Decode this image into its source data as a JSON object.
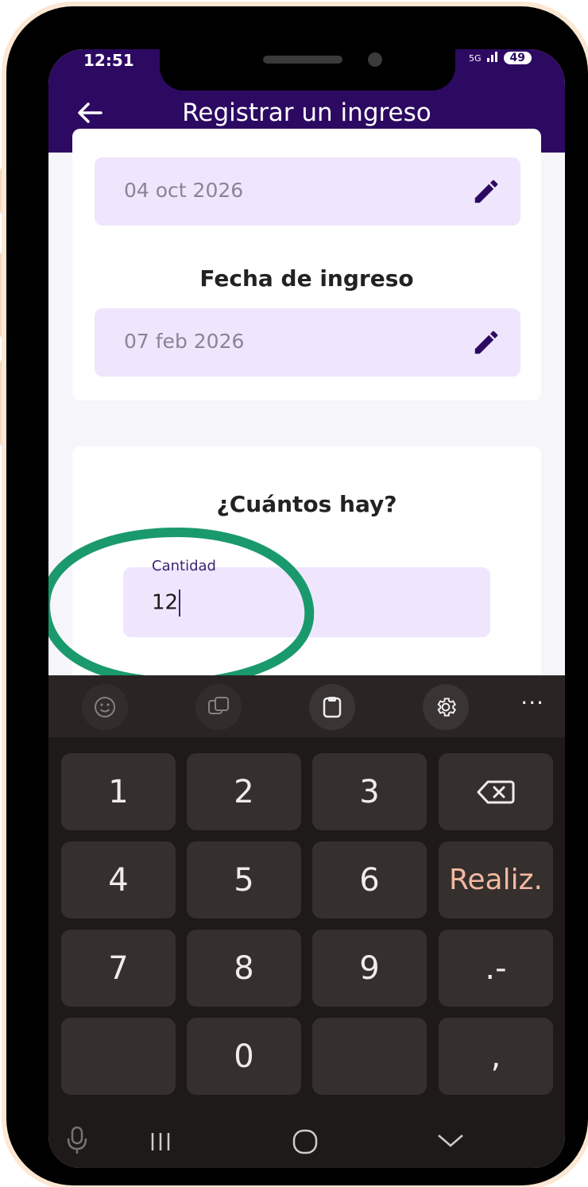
{
  "status_bar": {
    "time": "12:51",
    "network": "5G",
    "battery": "49"
  },
  "app_bar": {
    "title": "Registrar un ingreso"
  },
  "fields": {
    "first_date": {
      "value": "04 oct 2026"
    },
    "income_date": {
      "label": "Fecha de ingreso",
      "value": "07 feb 2026"
    }
  },
  "quantity": {
    "heading": "¿Cuántos hay?",
    "label": "Cantidad",
    "value": "12"
  },
  "keyboard": {
    "row1": [
      "1",
      "2",
      "3"
    ],
    "row2": [
      "4",
      "5",
      "6"
    ],
    "done_label": "Realiz.",
    "row3": [
      "7",
      "8",
      "9"
    ],
    "punct": ".-",
    "zero": "0",
    "comma": ",",
    "toolbar_more": "···"
  },
  "colors": {
    "accent": "#2d0a62",
    "field_bg": "#efe6fd",
    "highlight": "#1a9a6c"
  }
}
